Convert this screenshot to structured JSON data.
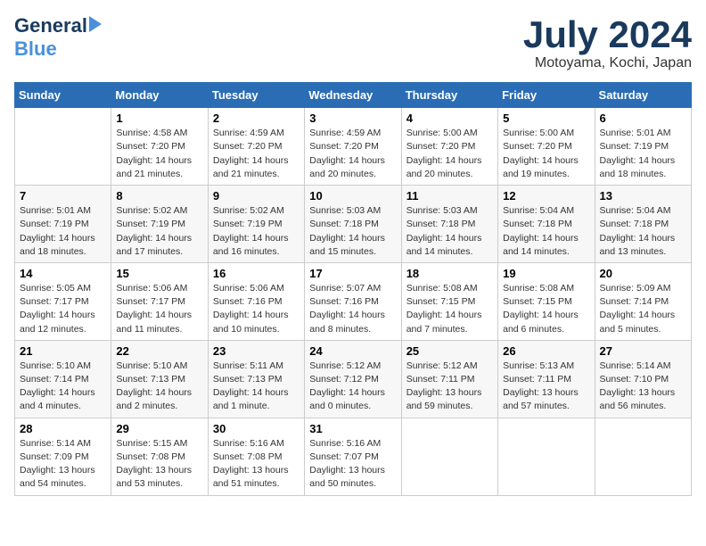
{
  "header": {
    "logo_general": "General",
    "logo_blue": "Blue",
    "month_title": "July 2024",
    "location": "Motoyama, Kochi, Japan"
  },
  "calendar": {
    "days_of_week": [
      "Sunday",
      "Monday",
      "Tuesday",
      "Wednesday",
      "Thursday",
      "Friday",
      "Saturday"
    ],
    "weeks": [
      [
        {
          "day": "",
          "info": ""
        },
        {
          "day": "1",
          "info": "Sunrise: 4:58 AM\nSunset: 7:20 PM\nDaylight: 14 hours\nand 21 minutes."
        },
        {
          "day": "2",
          "info": "Sunrise: 4:59 AM\nSunset: 7:20 PM\nDaylight: 14 hours\nand 21 minutes."
        },
        {
          "day": "3",
          "info": "Sunrise: 4:59 AM\nSunset: 7:20 PM\nDaylight: 14 hours\nand 20 minutes."
        },
        {
          "day": "4",
          "info": "Sunrise: 5:00 AM\nSunset: 7:20 PM\nDaylight: 14 hours\nand 20 minutes."
        },
        {
          "day": "5",
          "info": "Sunrise: 5:00 AM\nSunset: 7:20 PM\nDaylight: 14 hours\nand 19 minutes."
        },
        {
          "day": "6",
          "info": "Sunrise: 5:01 AM\nSunset: 7:19 PM\nDaylight: 14 hours\nand 18 minutes."
        }
      ],
      [
        {
          "day": "7",
          "info": "Sunrise: 5:01 AM\nSunset: 7:19 PM\nDaylight: 14 hours\nand 18 minutes."
        },
        {
          "day": "8",
          "info": "Sunrise: 5:02 AM\nSunset: 7:19 PM\nDaylight: 14 hours\nand 17 minutes."
        },
        {
          "day": "9",
          "info": "Sunrise: 5:02 AM\nSunset: 7:19 PM\nDaylight: 14 hours\nand 16 minutes."
        },
        {
          "day": "10",
          "info": "Sunrise: 5:03 AM\nSunset: 7:18 PM\nDaylight: 14 hours\nand 15 minutes."
        },
        {
          "day": "11",
          "info": "Sunrise: 5:03 AM\nSunset: 7:18 PM\nDaylight: 14 hours\nand 14 minutes."
        },
        {
          "day": "12",
          "info": "Sunrise: 5:04 AM\nSunset: 7:18 PM\nDaylight: 14 hours\nand 14 minutes."
        },
        {
          "day": "13",
          "info": "Sunrise: 5:04 AM\nSunset: 7:18 PM\nDaylight: 14 hours\nand 13 minutes."
        }
      ],
      [
        {
          "day": "14",
          "info": "Sunrise: 5:05 AM\nSunset: 7:17 PM\nDaylight: 14 hours\nand 12 minutes."
        },
        {
          "day": "15",
          "info": "Sunrise: 5:06 AM\nSunset: 7:17 PM\nDaylight: 14 hours\nand 11 minutes."
        },
        {
          "day": "16",
          "info": "Sunrise: 5:06 AM\nSunset: 7:16 PM\nDaylight: 14 hours\nand 10 minutes."
        },
        {
          "day": "17",
          "info": "Sunrise: 5:07 AM\nSunset: 7:16 PM\nDaylight: 14 hours\nand 8 minutes."
        },
        {
          "day": "18",
          "info": "Sunrise: 5:08 AM\nSunset: 7:15 PM\nDaylight: 14 hours\nand 7 minutes."
        },
        {
          "day": "19",
          "info": "Sunrise: 5:08 AM\nSunset: 7:15 PM\nDaylight: 14 hours\nand 6 minutes."
        },
        {
          "day": "20",
          "info": "Sunrise: 5:09 AM\nSunset: 7:14 PM\nDaylight: 14 hours\nand 5 minutes."
        }
      ],
      [
        {
          "day": "21",
          "info": "Sunrise: 5:10 AM\nSunset: 7:14 PM\nDaylight: 14 hours\nand 4 minutes."
        },
        {
          "day": "22",
          "info": "Sunrise: 5:10 AM\nSunset: 7:13 PM\nDaylight: 14 hours\nand 2 minutes."
        },
        {
          "day": "23",
          "info": "Sunrise: 5:11 AM\nSunset: 7:13 PM\nDaylight: 14 hours\nand 1 minute."
        },
        {
          "day": "24",
          "info": "Sunrise: 5:12 AM\nSunset: 7:12 PM\nDaylight: 14 hours\nand 0 minutes."
        },
        {
          "day": "25",
          "info": "Sunrise: 5:12 AM\nSunset: 7:11 PM\nDaylight: 13 hours\nand 59 minutes."
        },
        {
          "day": "26",
          "info": "Sunrise: 5:13 AM\nSunset: 7:11 PM\nDaylight: 13 hours\nand 57 minutes."
        },
        {
          "day": "27",
          "info": "Sunrise: 5:14 AM\nSunset: 7:10 PM\nDaylight: 13 hours\nand 56 minutes."
        }
      ],
      [
        {
          "day": "28",
          "info": "Sunrise: 5:14 AM\nSunset: 7:09 PM\nDaylight: 13 hours\nand 54 minutes."
        },
        {
          "day": "29",
          "info": "Sunrise: 5:15 AM\nSunset: 7:08 PM\nDaylight: 13 hours\nand 53 minutes."
        },
        {
          "day": "30",
          "info": "Sunrise: 5:16 AM\nSunset: 7:08 PM\nDaylight: 13 hours\nand 51 minutes."
        },
        {
          "day": "31",
          "info": "Sunrise: 5:16 AM\nSunset: 7:07 PM\nDaylight: 13 hours\nand 50 minutes."
        },
        {
          "day": "",
          "info": ""
        },
        {
          "day": "",
          "info": ""
        },
        {
          "day": "",
          "info": ""
        }
      ]
    ]
  }
}
